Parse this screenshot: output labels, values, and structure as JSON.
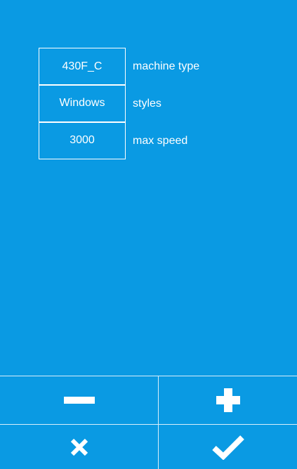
{
  "params": [
    {
      "value": "430F_C",
      "label": "machine type"
    },
    {
      "value": "Windows",
      "label": "styles"
    },
    {
      "value": "3000",
      "label": "max speed"
    }
  ],
  "controls": {
    "decrease_icon": "minus-icon",
    "increase_icon": "plus-icon",
    "cancel_icon": "close-icon",
    "confirm_icon": "checkmark-icon"
  },
  "colors": {
    "background": "#0a9ae3",
    "foreground": "#ffffff",
    "divider": "#d8effb"
  }
}
